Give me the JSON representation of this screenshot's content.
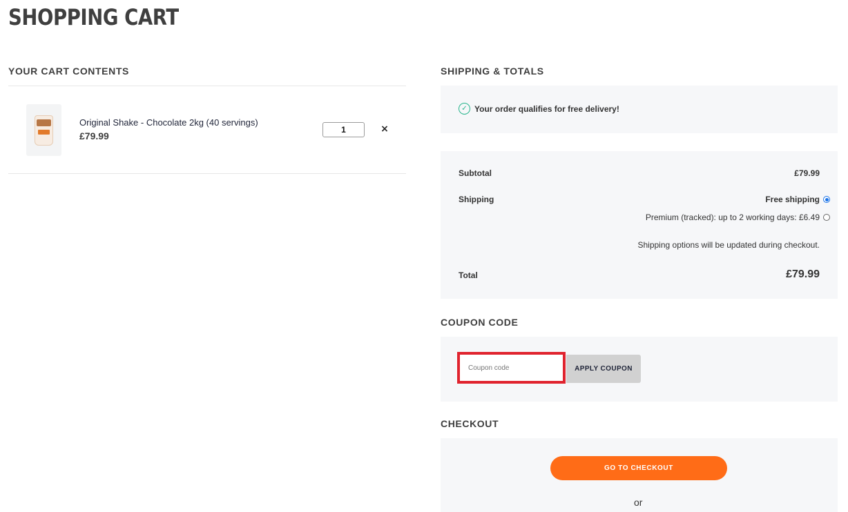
{
  "page": {
    "title": "SHOPPING CART"
  },
  "cart": {
    "heading": "YOUR CART CONTENTS",
    "items": [
      {
        "name": "Original Shake - Chocolate 2kg (40 servings)",
        "price": "£79.99",
        "quantity": "1",
        "remove_label": "×",
        "thumbnail_icon": "product-pouch-icon"
      }
    ]
  },
  "totals": {
    "heading": "SHIPPING & TOTALS",
    "free_delivery_message": "Your order qualifies for free delivery!",
    "subtotal_label": "Subtotal",
    "subtotal_value": "£79.99",
    "shipping_label": "Shipping",
    "shipping_options": [
      {
        "label": "Free shipping",
        "selected": true
      },
      {
        "label": "Premium (tracked): up to 2 working days: £6.49",
        "selected": false
      }
    ],
    "shipping_note": "Shipping options will be updated during checkout.",
    "total_label": "Total",
    "total_value": "£79.99"
  },
  "coupon": {
    "heading": "COUPON CODE",
    "placeholder": "Coupon code",
    "apply_label": "APPLY COUPON"
  },
  "checkout": {
    "heading": "CHECKOUT",
    "button_label": "GO TO CHECKOUT",
    "or_label": "or"
  },
  "colors": {
    "accent_orange": "#ff6c17",
    "success_green": "#25b48b",
    "highlight_red": "#e0232e",
    "panel_bg": "#f6f7f9"
  }
}
